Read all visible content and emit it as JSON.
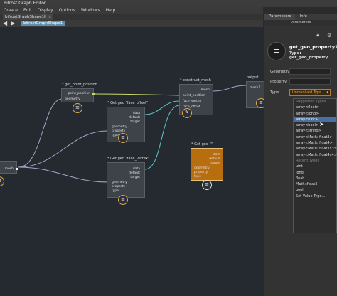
{
  "window": {
    "title": "Bifrost Graph Editor"
  },
  "menu": [
    "Create",
    "Edit",
    "Display",
    "Options",
    "Windows",
    "Help"
  ],
  "tab": {
    "label": "bifrostGraphShape1",
    "close": "×",
    "add": "+"
  },
  "nav": {
    "back": "◀",
    "fwd": "▶",
    "crumb": "bifrostGraphShape1"
  },
  "nodes": {
    "get_point_position": {
      "title": "* get_point_position",
      "ports": [
        "point_position",
        "geometry"
      ]
    },
    "construct_mesh": {
      "title": "* construct_mesh",
      "ports": [
        "mesh",
        "point_position",
        "face_vertex",
        "face_offset"
      ]
    },
    "output": {
      "title": "output",
      "ports": [
        "mesh1"
      ]
    },
    "get_geo_face_offset": {
      "title": "* Get geo \"face_offset\"",
      "ports": [
        "data",
        "default",
        "target",
        "geometry",
        "property",
        "type"
      ]
    },
    "get_geo_face_vertex": {
      "title": "* Get geo \"face_vertex\"",
      "ports": [
        "data",
        "default",
        "target",
        "geometry",
        "property",
        "type"
      ]
    },
    "get_geo_new": {
      "title": "* Get geo \"\"",
      "ports": [
        "data",
        "default",
        "target",
        "geometry",
        "property",
        "type"
      ]
    },
    "input": {
      "ports": [
        "mesh"
      ]
    }
  },
  "right_panel": {
    "tabs": [
      "Parameters",
      "Info"
    ],
    "section": "Parameters",
    "node_name": "get_geo_property2",
    "node_type": "Type: get_geo_property",
    "fields": {
      "geometry": "Geometry",
      "property": "Property",
      "type": "Type"
    },
    "type_value": "Unresolved Type",
    "dropdown": {
      "suggested_header": "Suggested Types",
      "suggested": [
        "array<float>",
        "array<long>",
        "array<uint>",
        "array<bool>",
        "array<string>",
        "array<Math::float3>",
        "array<Math::float4>",
        "array<Math::float3x3>",
        "array<Math::float4x4>"
      ],
      "recent_header": "Recent Types",
      "recent": [
        "uint",
        "long",
        "float",
        "Math::float3",
        "bool"
      ],
      "footer": "Set Value Type..."
    }
  },
  "colors": {
    "accent_orange": "#e2a844",
    "selected_node": "#b86e0f",
    "highlight_blue": "#4a6fa3"
  }
}
